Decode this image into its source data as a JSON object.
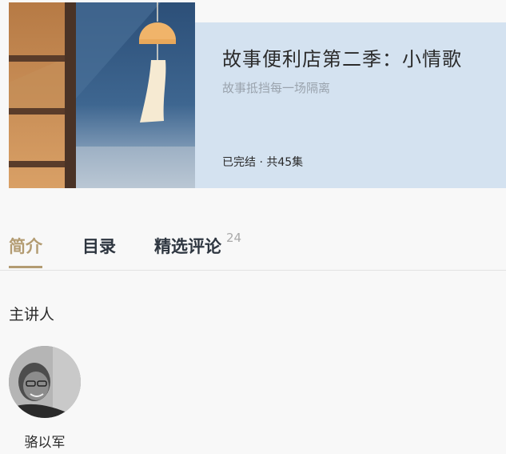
{
  "album": {
    "title": "故事便利店第二季：小情歌",
    "subtitle": "故事抵挡每一场隔离",
    "status": "已完结 · 共45集"
  },
  "tabs": [
    {
      "label": "简介",
      "active": true
    },
    {
      "label": "目录",
      "active": false
    },
    {
      "label": "精选评论",
      "count": "24",
      "active": false
    }
  ],
  "presenters_section": {
    "title": "主讲人",
    "presenters": [
      {
        "name": "骆以军"
      }
    ]
  },
  "colors": {
    "accent": "#b39c72",
    "info_panel_bg": "#d4e2f0",
    "cover_blue": "#2e5580",
    "cover_wood": "#c08a55",
    "cover_bell": "#f0b46a"
  },
  "icons": {
    "cover": "wind-chime-window-illustration",
    "avatar": "presenter-photo"
  }
}
